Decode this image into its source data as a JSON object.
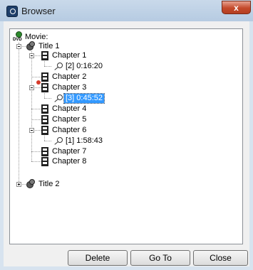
{
  "window": {
    "title": "Browser",
    "close_glyph": "x"
  },
  "tree": {
    "root": {
      "label": "Movie:",
      "icon": "dvd-icon",
      "disc_label": "DVD"
    },
    "titles": [
      {
        "label": "Title 1",
        "expanded": true,
        "chapters": [
          {
            "label": "Chapter 1",
            "expanded": true,
            "time": "[2]  0:16:20"
          },
          {
            "label": "Chapter 2"
          },
          {
            "label": "Chapter 3",
            "expanded": true,
            "time": "[3]  0:45:52",
            "selected": true
          },
          {
            "label": "Chapter 4"
          },
          {
            "label": "Chapter 5"
          },
          {
            "label": "Chapter 6",
            "expanded": true,
            "time": "[1]  1:58:43"
          },
          {
            "label": "Chapter 7"
          },
          {
            "label": "Chapter 8"
          }
        ]
      },
      {
        "label": "Title 2",
        "expanded": false
      }
    ]
  },
  "buttons": {
    "delete": "Delete",
    "goto": "Go To",
    "close": "Close"
  }
}
